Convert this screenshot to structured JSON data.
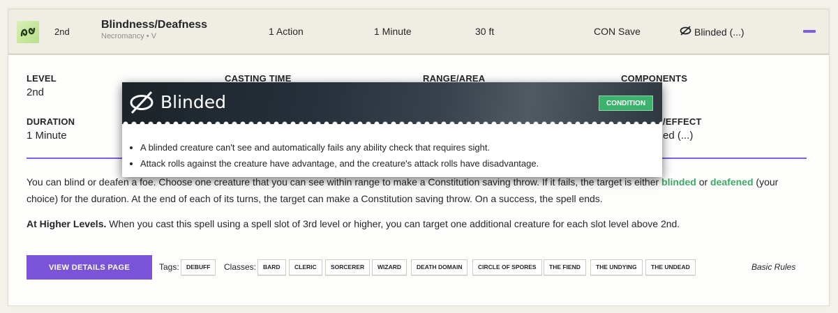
{
  "colors": {
    "accent": "#7d5ee0",
    "condition": "#3ea868",
    "button": "#7954d8"
  },
  "spell": {
    "level": "2nd",
    "name": "Blindness/Deafness",
    "school": "Necromancy • V",
    "casting_time": "1 Action",
    "duration": "1 Minute",
    "range": "30 ft",
    "save": "CON Save",
    "effect": "Blinded (...)",
    "school_icon": "necromancy-icon"
  },
  "details": {
    "level_label": "LEVEL",
    "level_value": "2nd",
    "casting_label": "CASTING TIME",
    "range_label": "RANGE/AREA",
    "components_label": "COMPONENTS",
    "duration_label": "DURATION",
    "duration_value": "1 Minute",
    "effect_label_partial": "/EFFECT",
    "effect_value_partial": "ed (...)"
  },
  "description": {
    "p1_before": "You can blind or deafen a foe. Choose one creature that you can see within range to make a Constitution saving throw. If it fails, the target is either ",
    "blinded": "blinded",
    "or": " or ",
    "deafened": "deafened",
    "p1_after": " (your choice) for the duration. At the end of each of its turns, the target can make a Constitution saving throw. On a success, the spell ends.",
    "higher_label": "At Higher Levels.",
    "higher_text": " When you cast this spell using a spell slot of 3rd level or higher, you can target one additional creature for each slot level above 2nd."
  },
  "footer": {
    "view_button": "VIEW DETAILS PAGE",
    "tags_label": "Tags:",
    "tags": [
      "DEBUFF"
    ],
    "classes_label": "Classes:",
    "classes": [
      "BARD",
      "CLERIC",
      "SORCERER",
      "WIZARD",
      "DEATH DOMAIN",
      "CIRCLE OF SPORES",
      "THE FIEND",
      "THE UNDYING",
      "THE UNDEAD"
    ],
    "source": "Basic Rules"
  },
  "tooltip": {
    "title": "Blinded",
    "badge": "CONDITION",
    "icon": "eye-slash-icon",
    "items": [
      "A blinded creature can't see and automatically fails any ability check that requires sight.",
      "Attack rolls against the creature have advantage, and the creature's attack rolls have disadvantage."
    ]
  }
}
